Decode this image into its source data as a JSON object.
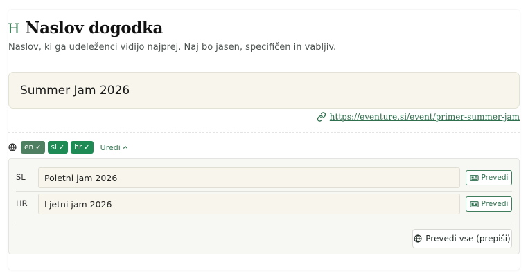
{
  "header": {
    "icon": "heading-icon",
    "icon_glyph": "H",
    "title": "Naslov dogodka",
    "subtitle": "Naslov, ki ga udeleženci vidijo najprej. Naj bo jasen, specifičen in vabljiv."
  },
  "main_title": {
    "value": "Summer Jam 2026"
  },
  "url": {
    "icon": "link-icon",
    "text": "https://eventure.si/event/primer-summer-jam"
  },
  "languages": {
    "icon": "globe-icon",
    "badges": [
      {
        "code": "en",
        "check": "✓"
      },
      {
        "code": "sl",
        "check": "✓"
      },
      {
        "code": "hr",
        "check": "✓"
      }
    ],
    "edit_label": "Uredi"
  },
  "translations": {
    "rows": [
      {
        "code": "SL",
        "value": "Poletni jam 2026",
        "button_label": "Prevedi"
      },
      {
        "code": "HR",
        "value": "Ljetni jam 2026",
        "button_label": "Prevedi"
      }
    ],
    "translate_all_label": "Prevedi vse (prepiši)"
  },
  "colors": {
    "accent": "#2f6f4e",
    "badge_en": "#4f7f61",
    "badge_active": "#1e8a54",
    "input_bg": "#f8f6ec"
  }
}
